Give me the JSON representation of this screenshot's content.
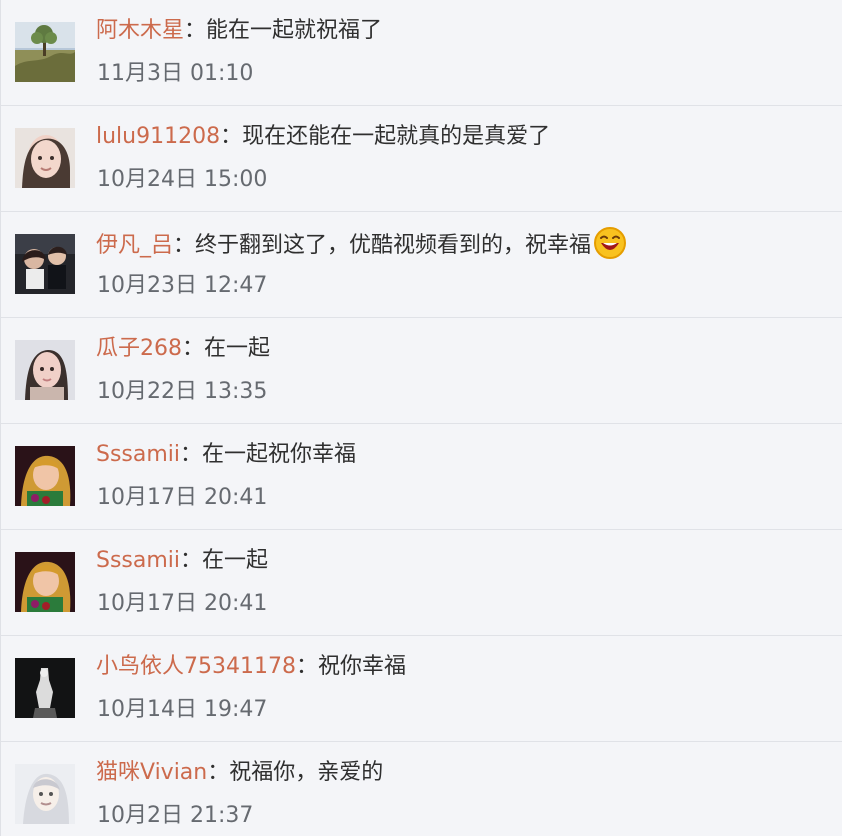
{
  "comments": [
    {
      "username": "阿木木星",
      "separator": "：",
      "text": "能在一起就祝福了",
      "time": "11月3日 01:10",
      "avatar": "landscape"
    },
    {
      "username": "lulu911208",
      "separator": "：",
      "text": "现在还能在一起就真的是真爱了",
      "time": "10月24日 15:00",
      "avatar": "woman"
    },
    {
      "username": "伊凡_吕",
      "separator": "：",
      "text": "终于翻到这了，优酷视频看到的，祝幸福",
      "time": "10月23日 12:47",
      "avatar": "couple",
      "emoji": "laughing-emoji"
    },
    {
      "username": "瓜子268",
      "separator": "：",
      "text": "在一起",
      "time": "10月22日 13:35",
      "avatar": "woman"
    },
    {
      "username": "Sssamii",
      "separator": "：",
      "text": "在一起祝你幸福",
      "time": "10月17日 20:41",
      "avatar": "blonde"
    },
    {
      "username": "Sssamii",
      "separator": "：",
      "text": "在一起",
      "time": "10月17日 20:41",
      "avatar": "blonde"
    },
    {
      "username": "小鸟依人75341178",
      "separator": "：",
      "text": "祝你幸福",
      "time": "10月14日 19:47",
      "avatar": "dark"
    },
    {
      "username": "猫咪Vivian",
      "separator": "：",
      "text": "祝福你，亲爱的",
      "time": "10月2日 21:37",
      "avatar": "light"
    }
  ]
}
